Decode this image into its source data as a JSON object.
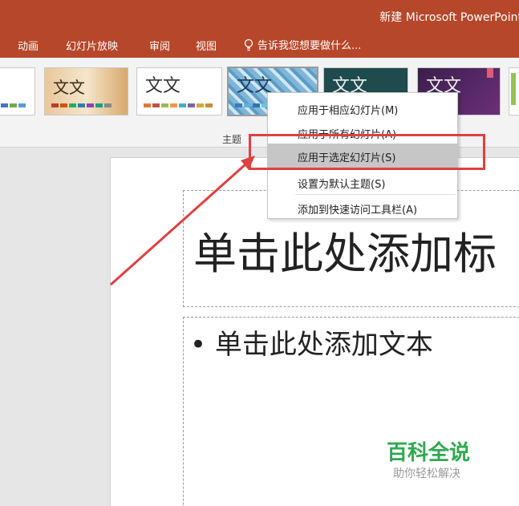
{
  "window": {
    "title": "新建 Microsoft PowerPoint"
  },
  "tabs": [
    {
      "label": "动画"
    },
    {
      "label": "幻灯片放映"
    },
    {
      "label": "审阅"
    },
    {
      "label": "视图"
    }
  ],
  "tell_me": {
    "label": "告诉我您想要做什么..."
  },
  "ribbon": {
    "group_label": "主题"
  },
  "themes": [
    {
      "name": "theme-1",
      "text": ""
    },
    {
      "name": "theme-2",
      "text": "文文"
    },
    {
      "name": "theme-3",
      "text": "文文"
    },
    {
      "name": "theme-4",
      "text": "文文"
    },
    {
      "name": "theme-5",
      "text": "文文"
    },
    {
      "name": "theme-6",
      "text": "文文"
    }
  ],
  "context_menu": {
    "items": [
      {
        "label": "应用于相应幻灯片(M)"
      },
      {
        "label": "应用于所有幻灯片(A)"
      },
      {
        "label": "应用于选定幻灯片(S)"
      },
      {
        "label": "设置为默认主题(S)"
      },
      {
        "label": "添加到快速访问工具栏(A)"
      }
    ]
  },
  "slide": {
    "title_placeholder": "单击此处添加标",
    "body_placeholder": "• 单击此处添加文本"
  },
  "watermark": {
    "title": "百科全说",
    "subtitle": "助你轻松解决"
  },
  "colors": {
    "accent": "#b7472a",
    "highlight": "#e04040",
    "watermark": "#2fa84f"
  }
}
